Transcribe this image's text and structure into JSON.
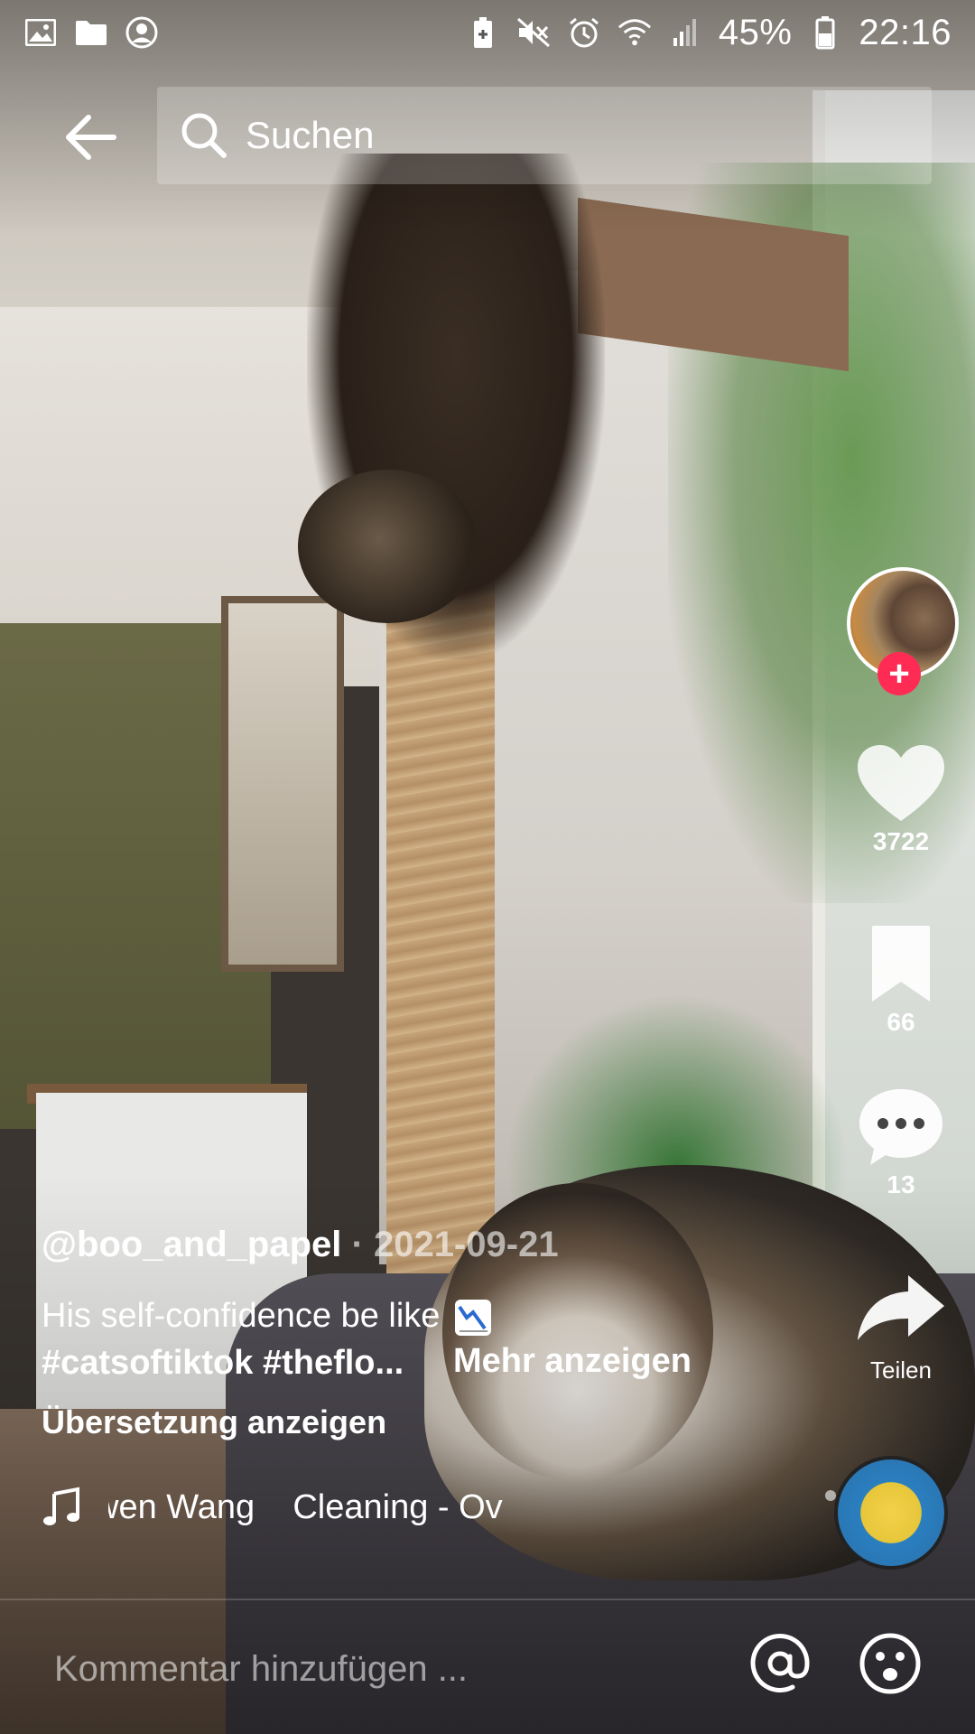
{
  "status_bar": {
    "battery": "45%",
    "time": "22:16"
  },
  "search": {
    "placeholder": "Suchen"
  },
  "video": {
    "author": "@boo_and_papel",
    "date": "· 2021-09-21",
    "caption": "His self-confidence be like",
    "hashtags": "#catsoftiktok #theflo...",
    "more_label": "Mehr anzeigen",
    "translate_label": "Übersetzung anzeigen",
    "music": "wen Wang    Cleaning - Ov"
  },
  "actions": {
    "likes": "3722",
    "bookmarks": "66",
    "comments": "13",
    "share_label": "Teilen",
    "follow_symbol": "+"
  },
  "comment_bar": {
    "placeholder": "Kommentar hinzufügen ..."
  },
  "colors": {
    "accent": "#fe2c55"
  },
  "icons": [
    "image-icon",
    "folder-icon",
    "account-circle-icon",
    "battery-saver-icon",
    "mute-icon",
    "alarm-icon",
    "wifi-icon",
    "signal-icon",
    "battery-icon",
    "back-arrow-icon",
    "search-icon",
    "heart-icon",
    "bookmark-icon",
    "comment-icon",
    "share-icon",
    "music-note-icon",
    "at-mention-icon",
    "emoji-icon"
  ]
}
